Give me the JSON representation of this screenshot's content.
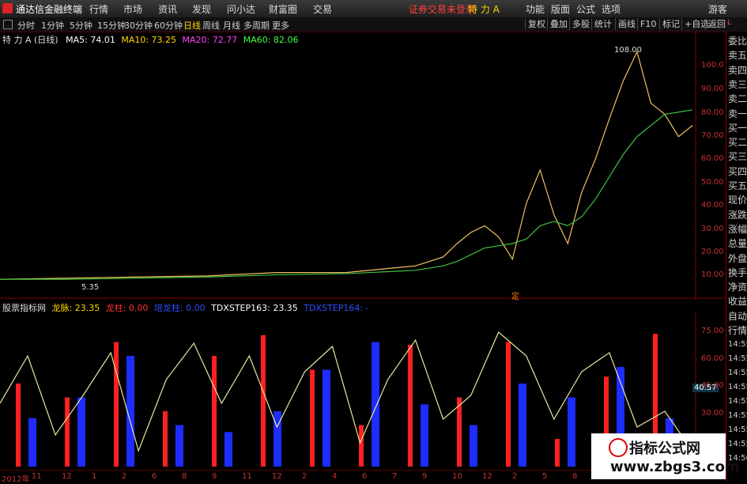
{
  "app": {
    "title": "通达信金融终端",
    "menus": [
      "行情",
      "市场",
      "资讯",
      "发现",
      "问小达",
      "财富圈",
      "交易"
    ],
    "status": "证券交易未登录",
    "stock_header": "特 力 A",
    "right_menus": [
      "功能",
      "版面",
      "公式",
      "选项"
    ],
    "guest": "游客"
  },
  "timeframes": [
    "分时",
    "1分钟",
    "5分钟",
    "15分钟",
    "30分钟",
    "60分钟",
    "日线",
    "周线",
    "月线",
    "多周期",
    "更多"
  ],
  "toolbar": [
    "复权",
    "叠加",
    "多股",
    "统计",
    "画线",
    "F10",
    "标记",
    "+自选",
    "返回"
  ],
  "ma_legend": {
    "name": "特 力 A (日线)",
    "ma5": "MA5: 74.01",
    "ma10": "MA10: 73.25",
    "ma20": "MA20: 72.77",
    "ma60": "MA60: 82.06",
    "colors": {
      "ma5": "#ffffff",
      "ma10": "#ffd700",
      "ma20": "#ff40ff",
      "ma60": "#40ff40"
    }
  },
  "price_axis": [
    "100.0",
    "90.00",
    "80.00",
    "70.00",
    "60.00",
    "50.00",
    "40.00",
    "30.00",
    "20.00",
    "10.00"
  ],
  "price_marks": {
    "high": "108.00",
    "low": "5.35",
    "event": "定"
  },
  "indicator": {
    "name": "股票指标网",
    "items": [
      {
        "label": "龙脉: 23.35",
        "color": "#ffd700"
      },
      {
        "label": "龙柱: 0.00",
        "color": "#ff3030"
      },
      {
        "label": "培龙柱: 0.00",
        "color": "#3050ff"
      },
      {
        "label": "TDXSTEP163: 23.35",
        "color": "#ffffff"
      },
      {
        "label": "TDXSTEP164: -",
        "color": "#3050ff"
      }
    ]
  },
  "ind_axis": [
    "75.00",
    "60.00",
    "45.00",
    "30.00"
  ],
  "ind_readout": "40.57",
  "right_panel": [
    "委比",
    "卖五",
    "卖四",
    "卖三",
    "卖二",
    "卖一",
    "买一",
    "买二",
    "买三",
    "买四",
    "买五",
    "现价",
    "涨跌",
    "涨幅",
    "总量",
    "外盘",
    "换手",
    "净资",
    "收益",
    "自动",
    "行情"
  ],
  "right_times": [
    "14:55",
    "14:55",
    "14:55",
    "14:55",
    "14:55",
    "14:55",
    "14:55",
    "14:55",
    "14:56"
  ],
  "date_axis": [
    "2012年",
    "11",
    "12",
    "1",
    "2",
    "6",
    "8",
    "9",
    "11",
    "12",
    "2",
    "4",
    "6",
    "7",
    "9",
    "10",
    "12",
    "2",
    "5",
    "8",
    "10",
    "12",
    "2"
  ],
  "watermark": {
    "title": "指标公式网",
    "url": "www.zbgs3.com"
  },
  "chart_data": {
    "type": "line",
    "x": [
      0,
      10,
      20,
      30,
      40,
      50,
      60,
      64,
      66,
      68,
      70,
      72,
      74,
      76,
      78,
      80,
      82,
      84,
      86,
      88,
      90,
      92,
      94,
      96,
      98,
      100
    ],
    "series": [
      {
        "name": "close",
        "values": [
          6,
          6.5,
          7,
          7.5,
          9,
          9,
          12,
          16,
          22,
          27,
          30,
          25,
          15,
          40,
          55,
          35,
          22,
          45,
          60,
          78,
          95,
          108,
          85,
          80,
          70,
          75
        ]
      },
      {
        "name": "MA60",
        "values": [
          6,
          6,
          6.5,
          7,
          8,
          8.5,
          10,
          12,
          14,
          17,
          20,
          21,
          22,
          24,
          30,
          32,
          30,
          34,
          42,
          52,
          62,
          70,
          75,
          80,
          81,
          82
        ]
      }
    ],
    "ylim": [
      0,
      110
    ],
    "ind_series": [
      40,
      70,
      20,
      45,
      72,
      10,
      55,
      78,
      40,
      70,
      25,
      60,
      76,
      15,
      55,
      80,
      30,
      45,
      85,
      70,
      30,
      60,
      72,
      25,
      35,
      10
    ],
    "red_bars": [
      0.6,
      0.5,
      0.9,
      0.4,
      0.8,
      0.95,
      0.7,
      0.3,
      0.88,
      0.5,
      0.9,
      0.2,
      0.65,
      0.96
    ],
    "blue_bars": [
      0.35,
      0.5,
      0.8,
      0.3,
      0.25,
      0.4,
      0.7,
      0.9,
      0.45,
      0.3,
      0.6,
      0.5,
      0.72,
      0.35
    ]
  }
}
